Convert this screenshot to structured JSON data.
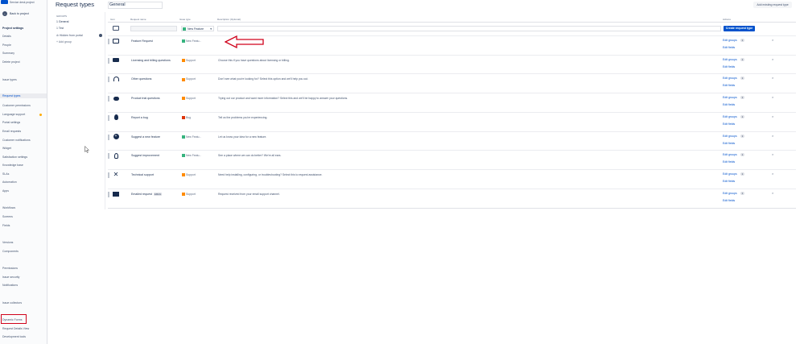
{
  "sidebar": {
    "project_name": "Service desk project",
    "back_label": "Back to project",
    "items": [
      {
        "label": "Project settings",
        "heading": true
      },
      {
        "label": "Details"
      },
      {
        "label": "People"
      },
      {
        "label": "Summary"
      },
      {
        "label": "Delete project"
      },
      {
        "label": "Issue types"
      },
      {
        "label": "Request types",
        "active": true
      },
      {
        "label": "Customer permissions"
      },
      {
        "label": "Language support",
        "dot": true
      },
      {
        "label": "Portal settings"
      },
      {
        "label": "Email requests"
      },
      {
        "label": "Customer notifications"
      },
      {
        "label": "Widget"
      },
      {
        "label": "Satisfaction settings"
      },
      {
        "label": "Knowledge base"
      },
      {
        "label": "SLAs"
      },
      {
        "label": "Automation"
      },
      {
        "label": "Apps"
      },
      {
        "label": "Workflows"
      },
      {
        "label": "Screens"
      },
      {
        "label": "Fields"
      },
      {
        "label": "Versions"
      },
      {
        "label": "Components"
      },
      {
        "label": "Permissions"
      },
      {
        "label": "Issue security"
      },
      {
        "label": "Notifications"
      },
      {
        "label": "Issue collectors"
      },
      {
        "label": "Dynamic Forms",
        "highlighted": true
      },
      {
        "label": "Request Details View"
      },
      {
        "label": "Development tools"
      }
    ]
  },
  "page": {
    "title": "Request types",
    "groups_label": "GROUPS",
    "groups": [
      "1 General",
      "1 Test",
      "Hidden from portal"
    ],
    "add_group": "+ Add group",
    "group_name": "General",
    "add_existing": "Add existing request type"
  },
  "table": {
    "headers": {
      "icon": "Icon",
      "name": "Request name",
      "type": "Issue type",
      "desc": "Description (Optional)",
      "actions": "Actions"
    },
    "create_row": {
      "issue_type": "New Feature",
      "button": "Create request type"
    },
    "edit_groups": "Edit groups",
    "edit_fields": "Edit fields",
    "rows": [
      {
        "icon": "monitor-icon",
        "name": "Feature Request",
        "type": "New Featu...",
        "type_color": "#36b37e",
        "desc": "",
        "count": "1"
      },
      {
        "icon": "billing-icon",
        "name": "Licensing and billing questions",
        "type": "Support",
        "type_color": "#ff8b00",
        "desc": "Choose this if you have questions about licensing or billing.",
        "count": "1"
      },
      {
        "icon": "headset-icon",
        "name": "Other questions",
        "type": "Support",
        "type_color": "#ff8b00",
        "desc": "Don't see what you're looking for? Select this option and we'll help you out.",
        "count": "1"
      },
      {
        "icon": "chat-icon",
        "name": "Product trial questions",
        "type": "Support",
        "type_color": "#ff8b00",
        "desc": "Trying out our product and want more information? Select this and we'll be happy to answer your questions.",
        "count": "1"
      },
      {
        "icon": "bug-icon",
        "name": "Report a bug",
        "type": "Bug",
        "type_color": "#de350b",
        "desc": "Tell us the problems you're experiencing.",
        "count": "1"
      },
      {
        "icon": "plus-circle-icon",
        "name": "Suggest a new feature",
        "type": "New Featu...",
        "type_color": "#36b37e",
        "desc": "Let us know your idea for a new feature.",
        "count": "1"
      },
      {
        "icon": "lightbulb-icon",
        "name": "Suggest improvement",
        "type": "New Featu...",
        "type_color": "#36b37e",
        "desc": "See a place where we can do better? We're all ears.",
        "count": "1"
      },
      {
        "icon": "tools-icon",
        "name": "Technical support",
        "type": "Support",
        "type_color": "#ff8b00",
        "desc": "Need help installing, configuring, or troubleshooting? Select this to request assistance.",
        "count": "1"
      },
      {
        "icon": "mail-icon",
        "name": "Emailed request",
        "badge": "EMAIL",
        "type": "Support",
        "type_color": "#ff8b00",
        "desc": "Request received from your email support channel.",
        "count": "1"
      }
    ]
  },
  "annotation_color": "#d0021b"
}
